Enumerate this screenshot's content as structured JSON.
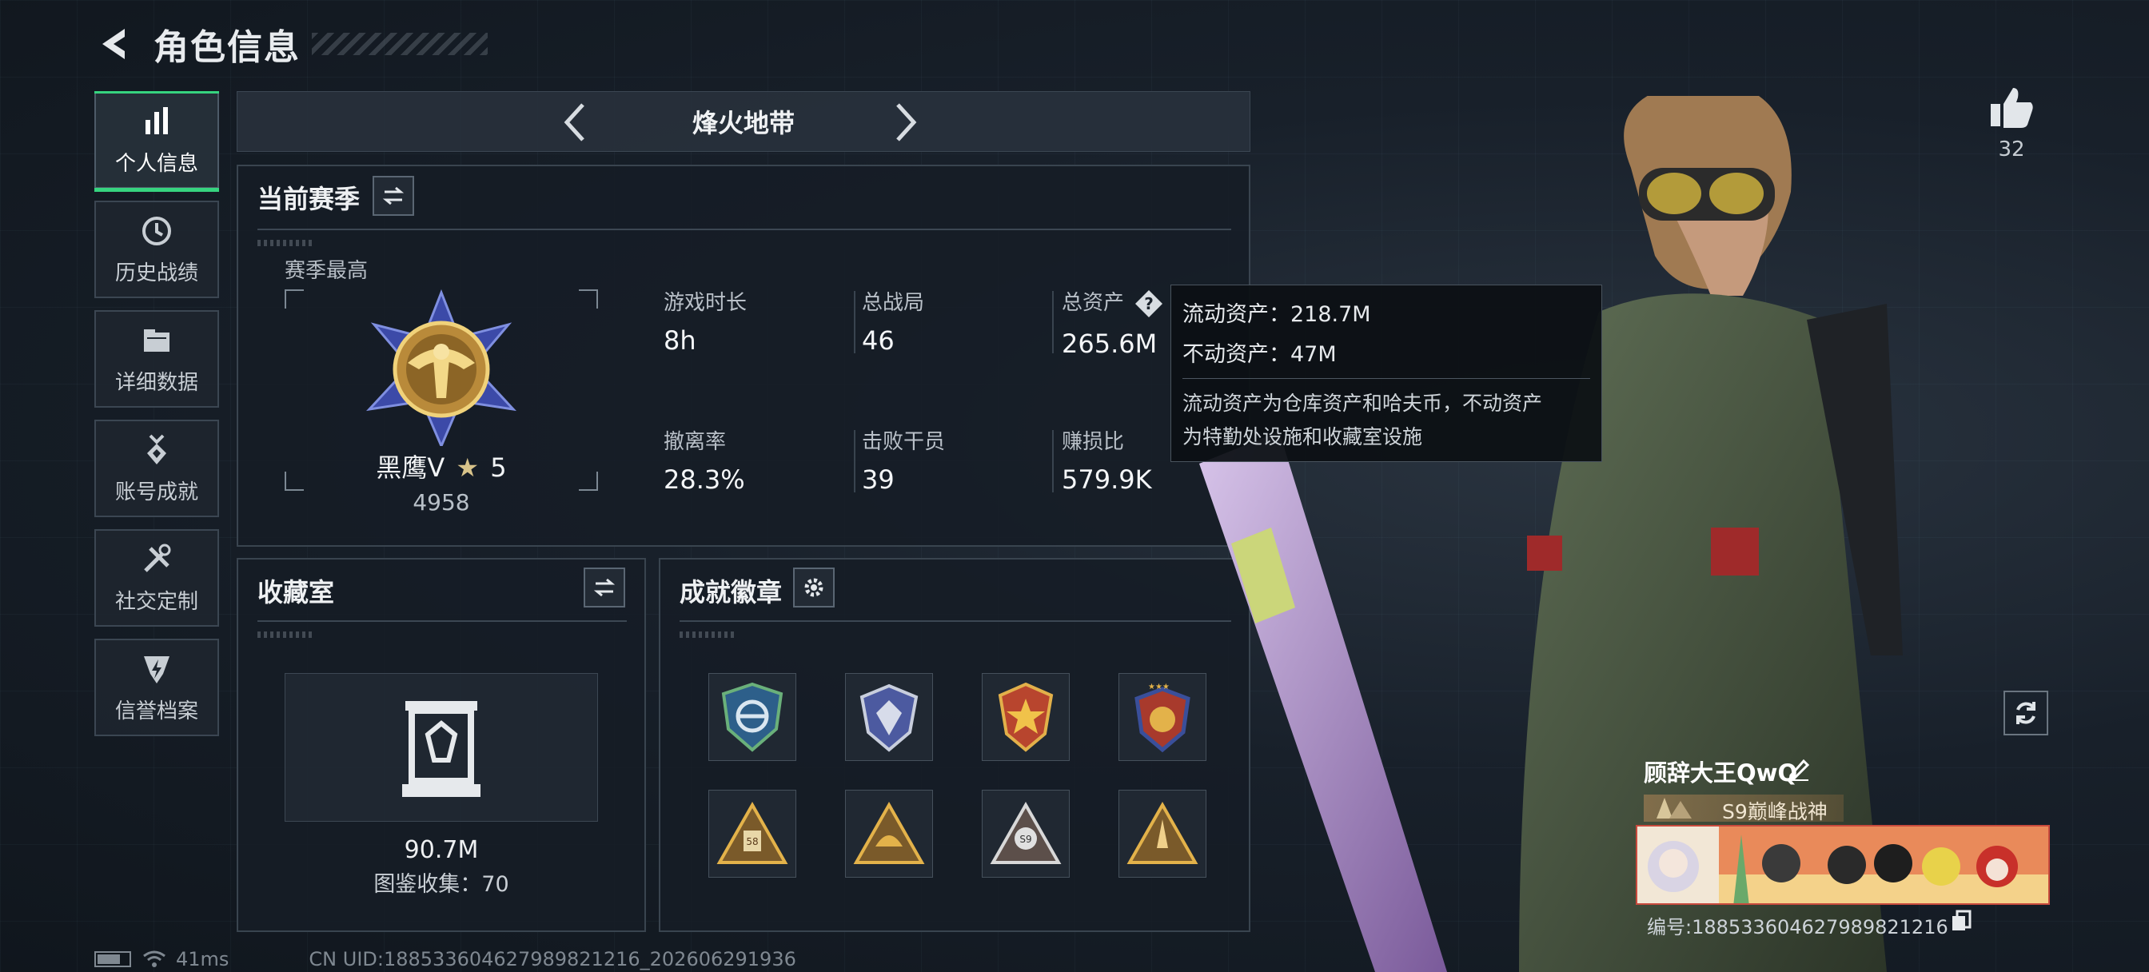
{
  "header": {
    "title": "角色信息"
  },
  "sidebar": {
    "items": [
      {
        "label": "个人信息",
        "icon": "bar-chart-icon",
        "active": true
      },
      {
        "label": "历史战绩",
        "icon": "history-icon"
      },
      {
        "label": "详细数据",
        "icon": "folder-icon"
      },
      {
        "label": "账号成就",
        "icon": "medal-icon"
      },
      {
        "label": "社交定制",
        "icon": "tools-icon"
      },
      {
        "label": "信誉档案",
        "icon": "shield-bolt-icon"
      }
    ]
  },
  "mode": {
    "name": "烽火地带"
  },
  "season": {
    "title": "当前赛季",
    "best_label": "赛季最高",
    "rank_name": "黑鹰V",
    "rank_stars": "5",
    "rank_score": "4958",
    "stats": [
      {
        "label": "游戏时长",
        "value": "8h"
      },
      {
        "label": "总战局",
        "value": "46"
      },
      {
        "label": "总资产",
        "value": "265.6M"
      },
      {
        "label": "撤离率",
        "value": "28.3%"
      },
      {
        "label": "击败干员",
        "value": "39"
      },
      {
        "label": "赚损比",
        "value": "579.9K"
      }
    ]
  },
  "tooltip": {
    "liquid": "流动资产：218.7M",
    "fixed": "不动资产：47M",
    "desc_line1": "流动资产为仓库资产和哈夫币，不动资产",
    "desc_line2": "为特勤处设施和收藏室设施"
  },
  "collection": {
    "title": "收藏室",
    "value": "90.7M",
    "collect_text": "图鉴收集：70"
  },
  "achievements": {
    "title": "成就徽章",
    "badges": [
      "badge-shield-blue",
      "badge-crest-silver",
      "badge-star-gold",
      "badge-emblem-red",
      "badge-triangle-58",
      "badge-triangle-helmet",
      "badge-triangle-s9",
      "badge-triangle-gold"
    ]
  },
  "status": {
    "ping": "41ms",
    "uid": "CN UID:188533604627989821216_202606291936"
  },
  "player": {
    "likes": "32",
    "name": "顾辞大王QwQ",
    "title": "S9巅峰战神",
    "id": "编号:188533604627989821216"
  },
  "colors": {
    "accent_green": "#36d47f",
    "panel_border": "#39444f",
    "background": "#18202a"
  }
}
